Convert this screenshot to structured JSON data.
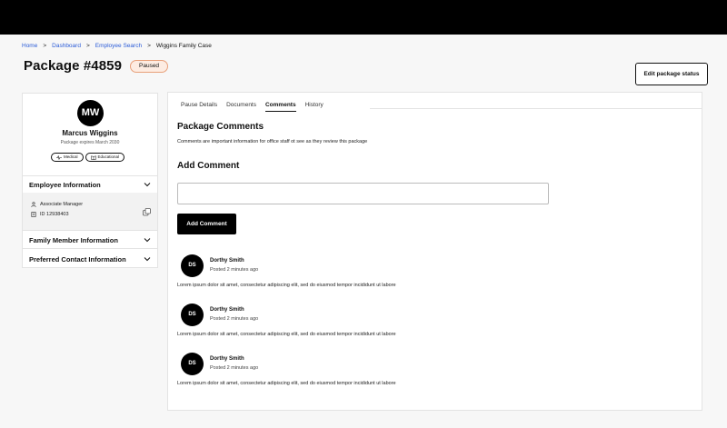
{
  "breadcrumb": {
    "items": [
      "Home",
      "Dashboard",
      "Employee Search"
    ],
    "separator": ">",
    "current": "Wiggins Family Case"
  },
  "header": {
    "title": "Package #4859",
    "status": "Paused",
    "edit_button": "Edit package status"
  },
  "profile": {
    "initials": "MW",
    "name": "Marcus Wiggins",
    "subtitle": "Package expires March 2030",
    "chips": [
      {
        "label": "Medical",
        "icon": "pulse-icon"
      },
      {
        "label": "Educational",
        "icon": "book-icon"
      }
    ]
  },
  "sections": {
    "employee_info": {
      "title": "Employee Information",
      "role": "Associate Manager",
      "id": "ID 12938403"
    },
    "family_member_info": {
      "title": "Family Member Information"
    },
    "preferred_contact": {
      "title": "Preferred Contact Information"
    }
  },
  "tabs": [
    {
      "label": "Pause Details",
      "active": false
    },
    {
      "label": "Documents",
      "active": false
    },
    {
      "label": "Comments",
      "active": true
    },
    {
      "label": "History",
      "active": false
    }
  ],
  "comments_panel": {
    "title": "Package Comments",
    "description": "Comments are important information for office staff ot see as they review this package",
    "add_title": "Add Comment",
    "input_value": "",
    "add_button": "Add Comment"
  },
  "comments": [
    {
      "initials": "DS",
      "author": "Dorthy Smith",
      "time": "Posted 2 minutes ago",
      "body": "Lorem ipsum dolor sit amet, consectetur adipiscing elit, sed do eiusmod tempor incididunt ut labore"
    },
    {
      "initials": "DS",
      "author": "Dorthy Smith",
      "time": "Posted 2 minutes ago",
      "body": "Lorem ipsum dolor sit amet, consectetur adipiscing elit, sed do eiusmod tempor incididunt ut labore"
    },
    {
      "initials": "DS",
      "author": "Dorthy Smith",
      "time": "Posted 2 minutes ago",
      "body": "Lorem ipsum dolor sit amet, consectetur adipiscing elit, sed do eiusmod tempor incididunt ut labore"
    }
  ],
  "colors": {
    "link": "#2a5bd7",
    "badge_border": "#e8a07a",
    "badge_bg": "#fdece2",
    "topbar": "#000000"
  }
}
